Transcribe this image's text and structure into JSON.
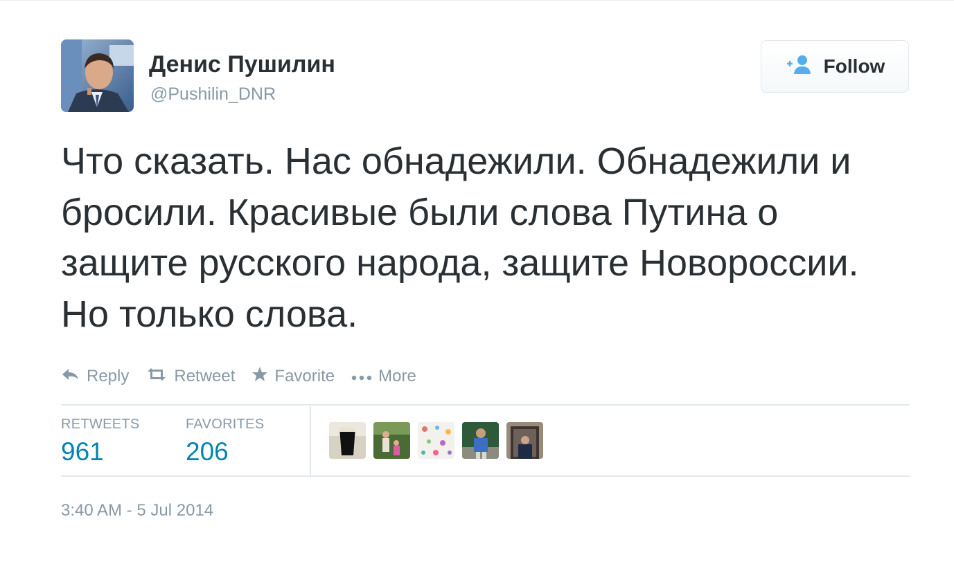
{
  "author": {
    "name": "Денис Пушилин",
    "handle": "@Pushilin_DNR"
  },
  "follow_button": {
    "label": "Follow",
    "icon": "add-user-icon"
  },
  "tweet": {
    "text": "Что сказать. Нас обнадежили. Обнадежили и бросили. Красивые были слова Путина о защите русского народа, защите Новороссии. Но только слова."
  },
  "actions": [
    {
      "label": "Reply",
      "icon": "reply-icon"
    },
    {
      "label": "Retweet",
      "icon": "retweet-icon"
    },
    {
      "label": "Favorite",
      "icon": "star-icon"
    },
    {
      "label": "More",
      "icon": "more-dots-icon"
    }
  ],
  "stats": {
    "retweets_label": "RETWEETS",
    "retweets_count": "961",
    "favorites_label": "FAVORITES",
    "favorites_count": "206"
  },
  "timestamp": "3:40 AM - 5 Jul 2014",
  "colors": {
    "text": "#292f33",
    "muted": "#8899a6",
    "link": "#0084b4",
    "follow_icon": "#55acee",
    "border": "#e1e8ed"
  }
}
